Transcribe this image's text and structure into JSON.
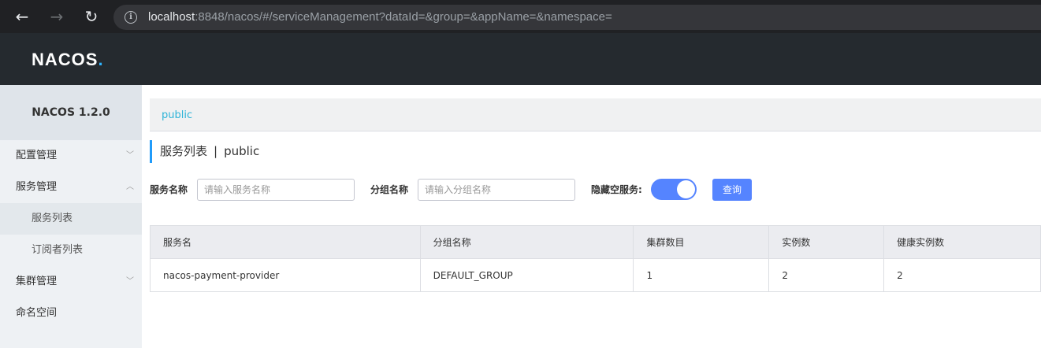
{
  "browser": {
    "back_glyph": "←",
    "forward_glyph": "→",
    "reload_glyph": "↻",
    "info_glyph": "i",
    "url_host": "localhost",
    "url_rest": ":8848/nacos/#/serviceManagement?dataId=&group=&appName=&namespace="
  },
  "header": {
    "logo_text": "NACOS",
    "logo_dot": "."
  },
  "sidebar": {
    "title": "NACOS 1.2.0",
    "items": [
      {
        "label": "配置管理",
        "chevron": "﹀"
      },
      {
        "label": "服务管理",
        "chevron": "︿"
      },
      {
        "label": "服务列表"
      },
      {
        "label": "订阅者列表"
      },
      {
        "label": "集群管理",
        "chevron": "﹀"
      },
      {
        "label": "命名空间"
      }
    ]
  },
  "namespace_bar": {
    "active": "public"
  },
  "page": {
    "title": "服务列表",
    "separator": "|",
    "namespace": "public"
  },
  "filters": {
    "service_name_label": "服务名称",
    "service_name_placeholder": "请输入服务名称",
    "group_name_label": "分组名称",
    "group_name_placeholder": "请输入分组名称",
    "hide_empty_label": "隐藏空服务:",
    "hide_empty_on": true,
    "query_button": "查询"
  },
  "table": {
    "headers": [
      "服务名",
      "分组名称",
      "集群数目",
      "实例数",
      "健康实例数"
    ],
    "rows": [
      [
        "nacos-payment-provider",
        "DEFAULT_GROUP",
        "1",
        "2",
        "2"
      ]
    ]
  },
  "colors": {
    "accent": "#5584ff",
    "link": "#2eb4d8",
    "header_bg": "#252a2f"
  }
}
